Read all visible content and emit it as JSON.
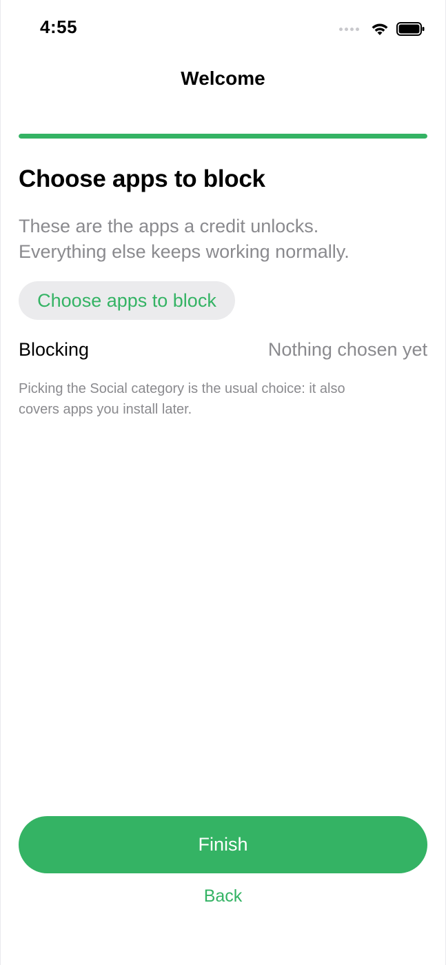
{
  "status_bar": {
    "time": "4:55",
    "icons": [
      "signal-icon",
      "wifi-icon",
      "battery-icon"
    ]
  },
  "nav": {
    "title": "Welcome"
  },
  "progress": {
    "fraction": 1.0,
    "color": "#34b364"
  },
  "content": {
    "heading": "Choose apps to block",
    "subtitle_line1": "These are the apps a credit unlocks.",
    "subtitle_line2": "Everything else keeps working normally.",
    "choose_button_label": "Choose apps to block",
    "blocking_label": "Blocking",
    "blocking_value": "Nothing chosen yet",
    "hint_line1": "Picking the Social category is the usual choice: it also",
    "hint_line2": "covers apps you install later."
  },
  "footer": {
    "finish_label": "Finish",
    "back_label": "Back"
  },
  "colors": {
    "accent": "#34b364",
    "secondary_text": "#8a8a8e",
    "button_bg": "#ebebed"
  }
}
